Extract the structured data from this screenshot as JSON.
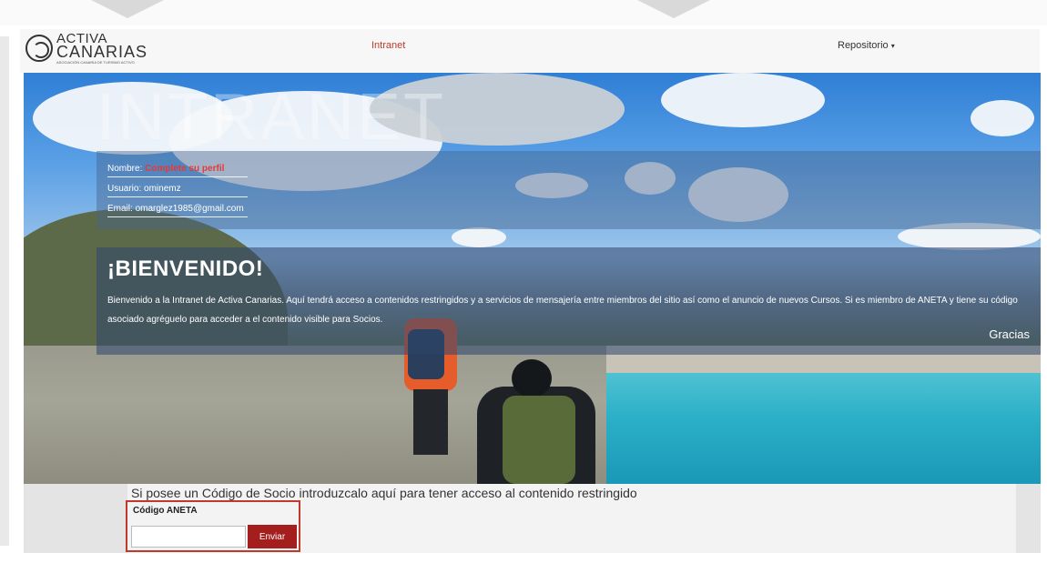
{
  "logo": {
    "line1": "ACTIVA",
    "line2": "CANARIAS",
    "tagline": "ASOCIACIÓN CANARIA DE TURISMO ACTIVO"
  },
  "nav": {
    "intranet": "Intranet",
    "repositorio": "Repositorio",
    "caret": "▾"
  },
  "hero": {
    "title": "INTRANET"
  },
  "profile": {
    "name_label": "Nombre:",
    "name_value": "Complete su perfil",
    "user_label": "Usuario:",
    "user_value": "ominemz",
    "email_label": "Email:",
    "email_value": "omarglez1985@gmail.com"
  },
  "welcome": {
    "title": "¡BIENVENIDO!",
    "text": "Bienvenido a la Intranet de Activa Canarias. Aquí tendrá acceso a contenidos restringidos y a servicios de mensajería entre miembros del sitio así como el anuncio de nuevos Cursos. Si es miembro de ANETA y tiene su código asociado agréguelo para acceder a el contenido visible para Socios.",
    "thanks": "Gracias"
  },
  "code_form": {
    "intro": "Si posee un Código de Socio introduzcalo aquí para tener acceso al contenido restringido",
    "label": "Código ANETA",
    "input_value": "",
    "button": "Enviar"
  },
  "colors": {
    "accent_red": "#c0392b",
    "button_red": "#a51e1e",
    "name_red": "#e53935"
  }
}
